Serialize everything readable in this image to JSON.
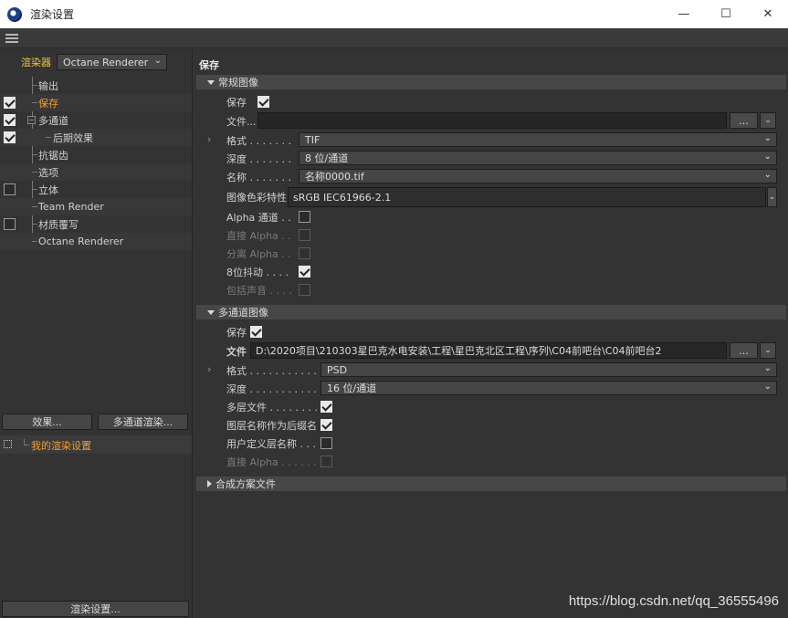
{
  "window": {
    "title": "渲染设置",
    "minimize": "—",
    "maximize": "☐",
    "close": "✕"
  },
  "left": {
    "renderer_label": "渲染器",
    "renderer_value": "Octane Renderer",
    "tree": [
      {
        "label": "输出",
        "checkbox": "none",
        "active": false
      },
      {
        "label": "保存",
        "checkbox": "checked",
        "active": true
      },
      {
        "label": "多通道",
        "checkbox": "checked",
        "active": false
      },
      {
        "label": "后期效果",
        "checkbox": "checked",
        "active": false
      },
      {
        "label": "抗锯齿",
        "checkbox": "none",
        "active": false
      },
      {
        "label": "选项",
        "checkbox": "none",
        "active": false
      },
      {
        "label": "立体",
        "checkbox": "unchecked",
        "active": false
      },
      {
        "label": "Team Render",
        "checkbox": "none",
        "active": false
      },
      {
        "label": "材质覆写",
        "checkbox": "unchecked",
        "active": false
      },
      {
        "label": "Octane Renderer",
        "checkbox": "none",
        "active": false
      }
    ],
    "effects_button": "效果...",
    "multipass_button": "多通道渲染...",
    "preset_label": "我的渲染设置",
    "render_settings_button": "渲染设置..."
  },
  "right": {
    "title": "保存",
    "regular": {
      "header": "常规图像",
      "save_label": "保存",
      "save_checked": true,
      "file_label": "文件...",
      "file_value": "",
      "browse": "...",
      "format_label": "格式 . . . . . . .",
      "format_value": "TIF",
      "depth_label": "深度 . . . . . . .",
      "depth_value": "8 位/通道",
      "name_label": "名称 . . . . . . .",
      "name_value": "名称0000.tif",
      "profile_label": "图像色彩特性",
      "profile_value": "sRGB IEC61966-2.1",
      "alpha_label": "Alpha 通道 . .",
      "straight_alpha_label": "直接 Alpha . .",
      "separate_alpha_label": "分离 Alpha . .",
      "dither_label": "8位抖动 . . . .",
      "dither_checked": true,
      "sound_label": "包括声音 . . . ."
    },
    "multipass": {
      "header": "多通道图像",
      "save_label": "保存",
      "save_checked": true,
      "file_label": "文件",
      "file_value": "D:\\2020项目\\210303星巴克水电安装\\工程\\星巴克北区工程\\序列\\C04前吧台\\C04前吧台2",
      "browse": "...",
      "format_label": "格式 . . . . . . . . . . .",
      "format_value": "PSD",
      "depth_label": "深度 . . . . . . . . . . .",
      "depth_value": "16 位/通道",
      "layered_label": "多层文件 . . . . . . . .",
      "layered_checked": true,
      "suffix_label": "图层名称作为后缀名",
      "suffix_checked": true,
      "userlayer_label": "用户定义层名称 . . .",
      "straight_alpha_label": "直接 Alpha . . . . . ."
    },
    "compositing": {
      "header": "合成方案文件"
    }
  },
  "watermark": "https://blog.csdn.net/qq_36555496",
  "colors": {
    "background": "#333333",
    "accent_active": "#f0a030",
    "renderer_label": "#f0c33c"
  }
}
